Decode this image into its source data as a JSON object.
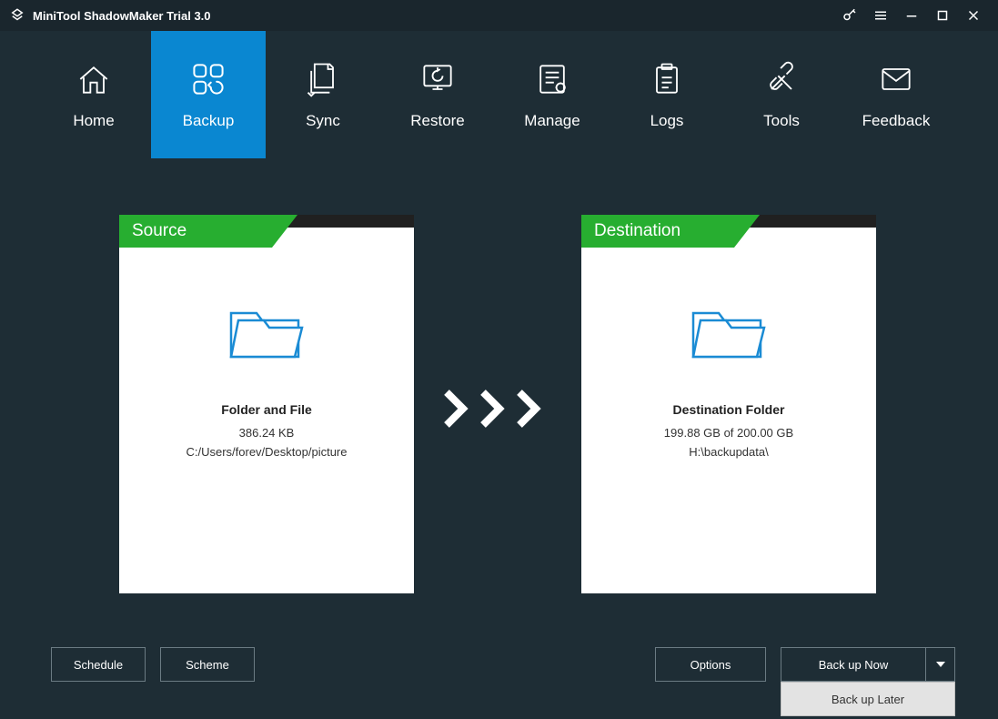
{
  "title": "MiniTool ShadowMaker Trial 3.0",
  "nav": {
    "items": [
      {
        "label": "Home"
      },
      {
        "label": "Backup"
      },
      {
        "label": "Sync"
      },
      {
        "label": "Restore"
      },
      {
        "label": "Manage"
      },
      {
        "label": "Logs"
      },
      {
        "label": "Tools"
      },
      {
        "label": "Feedback"
      }
    ]
  },
  "source": {
    "header": "Source",
    "title": "Folder and File",
    "size": "386.24 KB",
    "path": "C:/Users/forev/Desktop/picture"
  },
  "destination": {
    "header": "Destination",
    "title": "Destination Folder",
    "size": "199.88 GB of 200.00 GB",
    "path": "H:\\backupdata\\"
  },
  "buttons": {
    "schedule": "Schedule",
    "scheme": "Scheme",
    "options": "Options",
    "backup_now": "Back up Now",
    "backup_later": "Back up Later"
  }
}
